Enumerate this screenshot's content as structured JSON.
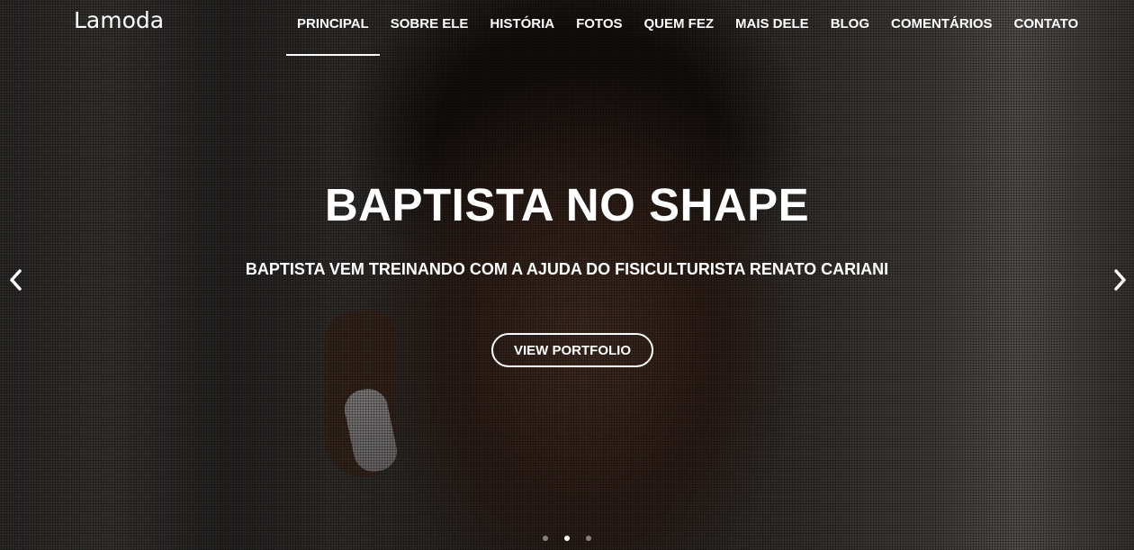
{
  "navbar": {
    "brand": "Lamoda",
    "items": [
      {
        "label": "PRINCIPAL",
        "active": true
      },
      {
        "label": "SOBRE ELE"
      },
      {
        "label": "HISTÓRIA"
      },
      {
        "label": "FOTOS"
      },
      {
        "label": "QUEM FEZ"
      },
      {
        "label": "MAIS DELE"
      },
      {
        "label": "BLOG"
      },
      {
        "label": "COMENTÁRIOS"
      },
      {
        "label": "CONTATO"
      }
    ]
  },
  "hero": {
    "title": "BAPTISTA NO SHAPE",
    "subtitle": "BAPTISTA VEM TREINANDO COM A AJUDA DO FISICULTURISTA RENATO CARIANI",
    "cta_label": "VIEW PORTFOLIO",
    "prev_icon": "chevron-left-icon",
    "next_icon": "chevron-right-icon",
    "slide_count": 3,
    "active_slide": 2
  }
}
